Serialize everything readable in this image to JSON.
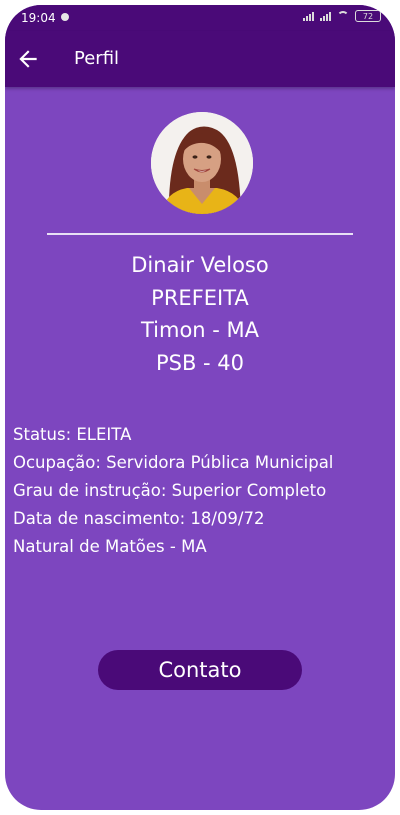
{
  "status_bar": {
    "time": "19:04",
    "battery": "72"
  },
  "appbar": {
    "title": "Perfil"
  },
  "profile": {
    "name": "Dinair Veloso",
    "office": "PREFEITA",
    "city": "Timon - MA",
    "party": "PSB - 40"
  },
  "details": {
    "status": "Status: ELEITA",
    "occupation": "Ocupação: Servidora Pública Municipal",
    "education": "Grau de instrução: Superior Completo",
    "birth": "Data de nascimento: 18/09/72",
    "origin": "Natural de Matões - MA"
  },
  "actions": {
    "contact_label": "Contato"
  },
  "colors": {
    "background": "#7d46bf",
    "appbar": "#4a0a78",
    "button": "#4a0a78",
    "text": "#ffffff"
  },
  "icons": {
    "back": "arrow-left-icon",
    "signal": "signal-icon",
    "wifi": "wifi-icon",
    "battery": "battery-icon",
    "notification": "notification-dot-icon"
  }
}
